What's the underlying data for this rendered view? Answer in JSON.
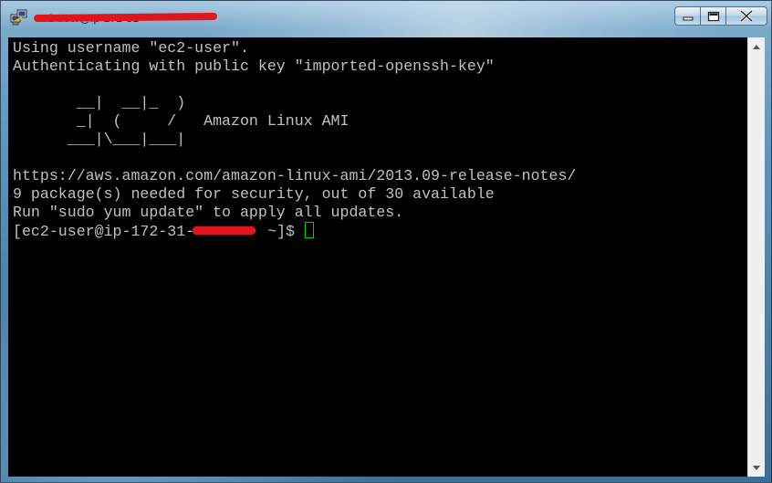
{
  "window": {
    "title": "ec2-user@ip-172-31-"
  },
  "caption": {
    "minimize_icon": "minimize-icon",
    "maximize_icon": "maximize-icon",
    "close_icon": "close-icon"
  },
  "terminal": {
    "lines": [
      "Using username \"ec2-user\".",
      "Authenticating with public key \"imported-openssh-key\"",
      "",
      "       __|  __|_  )",
      "       _|  (     /   Amazon Linux AMI",
      "      ___|\\___|___|",
      "",
      "https://aws.amazon.com/amazon-linux-ami/2013.09-release-notes/",
      "9 package(s) needed for security, out of 30 available",
      "Run \"sudo yum update\" to apply all updates."
    ],
    "prompt_prefix": "[ec2-user@ip-172-31-",
    "prompt_suffix": " ~]$ "
  },
  "colors": {
    "terminal_bg": "#000000",
    "terminal_fg": "#c0c0c0",
    "cursor": "#00d000",
    "redaction": "#e1151c"
  }
}
